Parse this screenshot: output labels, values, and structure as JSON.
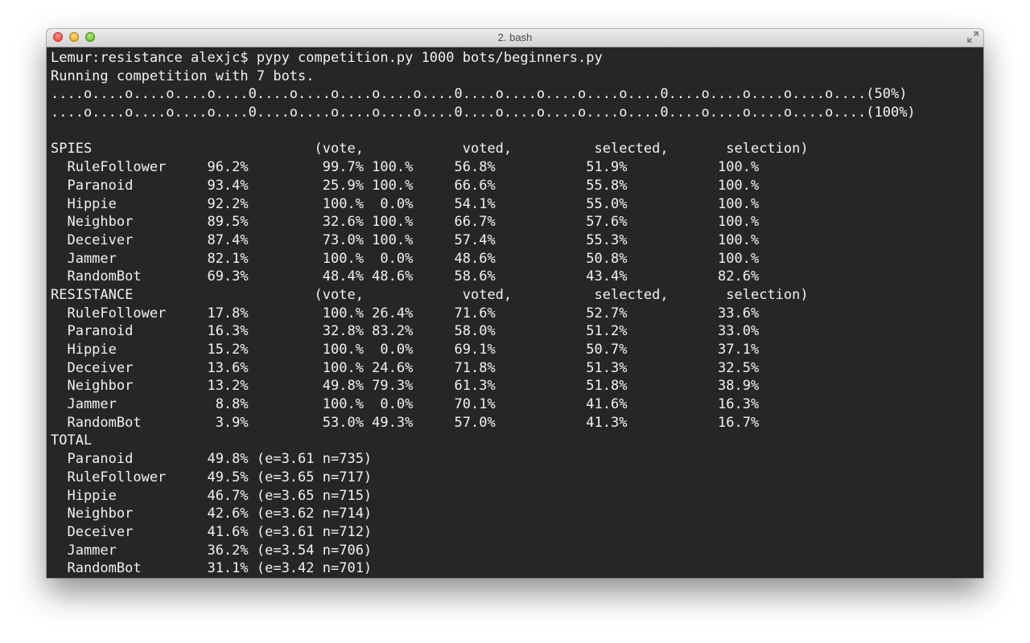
{
  "window": {
    "title": "2. bash"
  },
  "terminal": {
    "lines": [
      "Lemur:resistance alexjc$ pypy competition.py 1000 bots/beginners.py",
      "Running competition with 7 bots.",
      "....o....o....o....o....0....o....o....o....o....0....o....o....o....o....0....o....o....o....o....(50%)",
      "....o....o....o....o....0....o....o....o....o....0....o....o....o....o....0....o....o....o....o....(100%)",
      "",
      "SPIES                           (vote,            voted,          selected,       selection)",
      "  RuleFollower     96.2%         99.7% 100.%     56.8%           51.9%           100.%",
      "  Paranoid         93.4%         25.9% 100.%     66.6%           55.8%           100.%",
      "  Hippie           92.2%         100.%  0.0%     54.1%           55.0%           100.%",
      "  Neighbor         89.5%         32.6% 100.%     66.7%           57.6%           100.%",
      "  Deceiver         87.4%         73.0% 100.%     57.4%           55.3%           100.%",
      "  Jammer           82.1%         100.%  0.0%     48.6%           50.8%           100.%",
      "  RandomBot        69.3%         48.4% 48.6%     58.6%           43.4%           82.6%",
      "RESISTANCE                      (vote,            voted,          selected,       selection)",
      "  RuleFollower     17.8%         100.% 26.4%     71.6%           52.7%           33.6%",
      "  Paranoid         16.3%         32.8% 83.2%     58.0%           51.2%           33.0%",
      "  Hippie           15.2%         100.%  0.0%     69.1%           50.7%           37.1%",
      "  Deceiver         13.6%         100.% 24.6%     71.8%           51.3%           32.5%",
      "  Neighbor         13.2%         49.8% 79.3%     61.3%           51.8%           38.9%",
      "  Jammer            8.8%         100.%  0.0%     70.1%           41.6%           16.3%",
      "  RandomBot         3.9%         53.0% 49.3%     57.0%           41.3%           16.7%",
      "TOTAL",
      "  Paranoid         49.8% (e=3.61 n=735)",
      "  RuleFollower     49.5% (e=3.65 n=717)",
      "  Hippie           46.7% (e=3.65 n=715)",
      "  Neighbor         42.6% (e=3.62 n=714)",
      "  Deceiver         41.6% (e=3.61 n=712)",
      "  Jammer           36.2% (e=3.54 n=706)",
      "  RandomBot        31.1% (e=3.42 n=701)"
    ]
  }
}
